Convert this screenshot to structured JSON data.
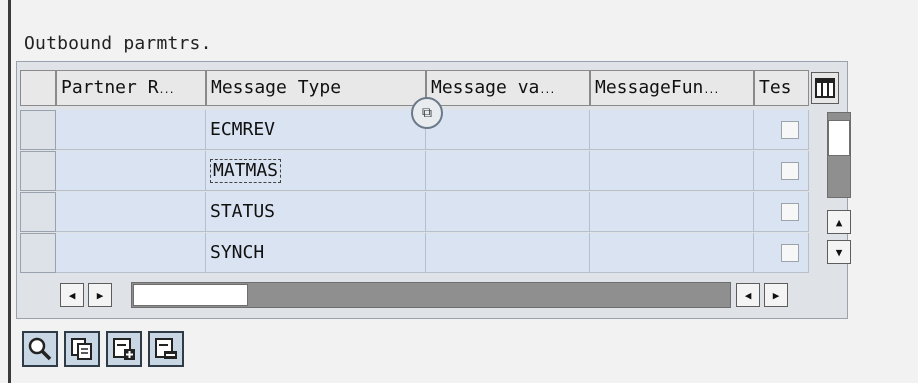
{
  "group": {
    "title": "Outbound parmtrs."
  },
  "table": {
    "columns": [
      {
        "label": "Partner R"
      },
      {
        "label": "Message Type"
      },
      {
        "label": "Message va"
      },
      {
        "label": "MessageFun"
      },
      {
        "label": "Tes"
      }
    ],
    "rows": [
      {
        "message_type": "ECMREV"
      },
      {
        "message_type": "MATMAS"
      },
      {
        "message_type": "STATUS"
      },
      {
        "message_type": "SYNCH"
      }
    ]
  },
  "icons": {
    "column_config": "table-settings-icon",
    "value_help": "value-help-icon",
    "details": "magnifier-icon",
    "copy": "copy-icon",
    "add": "add-entry-icon",
    "remove": "remove-entry-icon"
  }
}
